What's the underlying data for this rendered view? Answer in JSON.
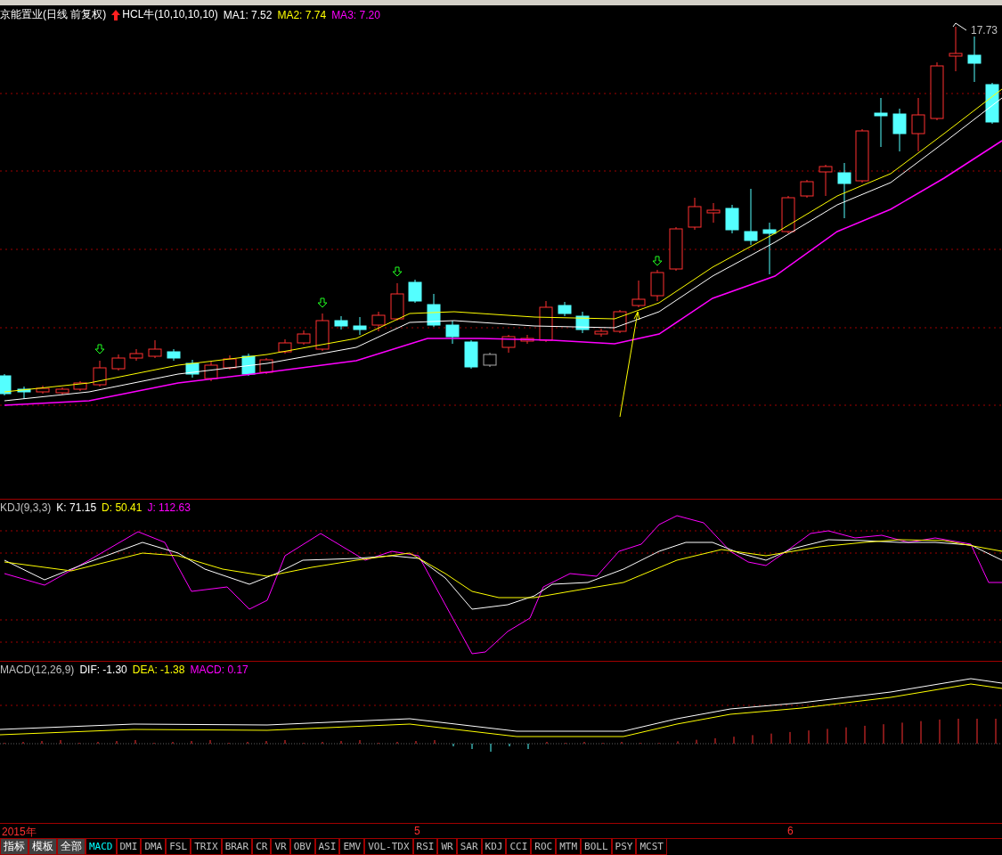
{
  "main_chart": {
    "title": "京能置业(日线 前复权)",
    "legend": [
      {
        "text": "HCL牛(10,10,10,10)",
        "color": "#ffffff",
        "kind": "signal"
      },
      {
        "text": "MA1: 7.52",
        "color": "#ffffff",
        "kind": "plain"
      },
      {
        "text": "MA2: 7.74",
        "color": "#ffff00",
        "kind": "plain"
      },
      {
        "text": "MA3: 7.20",
        "color": "#ff00ff",
        "kind": "plain"
      }
    ],
    "high_label": "17.73"
  },
  "kdj_panel": {
    "legend": [
      {
        "text": "KDJ(9,3,3)",
        "color": "#c0c0c0"
      },
      {
        "text": "K: 71.15",
        "color": "#ffffff"
      },
      {
        "text": "D: 50.41",
        "color": "#ffff00"
      },
      {
        "text": "J: 112.63",
        "color": "#ff00ff"
      }
    ]
  },
  "macd_panel": {
    "legend": [
      {
        "text": "MACD(12,26,9)",
        "color": "#c0c0c0"
      },
      {
        "text": "DIF: -1.30",
        "color": "#ffffff"
      },
      {
        "text": "DEA: -1.38",
        "color": "#ffff00"
      },
      {
        "text": "MACD: 0.17",
        "color": "#ff00ff"
      }
    ]
  },
  "date_axis": [
    "2015年",
    "5",
    "6"
  ],
  "tool_buttons": [
    "指标",
    "模板",
    "全部"
  ],
  "indicator_tabs": [
    {
      "label": "MACD",
      "selected": true
    },
    {
      "label": "DMI",
      "selected": false
    },
    {
      "label": "DMA",
      "selected": false
    },
    {
      "label": "FSL",
      "selected": false
    },
    {
      "label": "TRIX",
      "selected": false
    },
    {
      "label": "BRAR",
      "selected": false
    },
    {
      "label": "CR",
      "selected": false
    },
    {
      "label": "VR",
      "selected": false
    },
    {
      "label": "OBV",
      "selected": false
    },
    {
      "label": "ASI",
      "selected": false
    },
    {
      "label": "EMV",
      "selected": false
    },
    {
      "label": "VOL-TDX",
      "selected": false
    },
    {
      "label": "RSI",
      "selected": false
    },
    {
      "label": "WR",
      "selected": false
    },
    {
      "label": "SAR",
      "selected": false
    },
    {
      "label": "KDJ",
      "selected": false
    },
    {
      "label": "CCI",
      "selected": false
    },
    {
      "label": "ROC",
      "selected": false
    },
    {
      "label": "MTM",
      "selected": false
    },
    {
      "label": "BOLL",
      "selected": false
    },
    {
      "label": "PSY",
      "selected": false
    },
    {
      "label": "MCST",
      "selected": false
    }
  ]
}
